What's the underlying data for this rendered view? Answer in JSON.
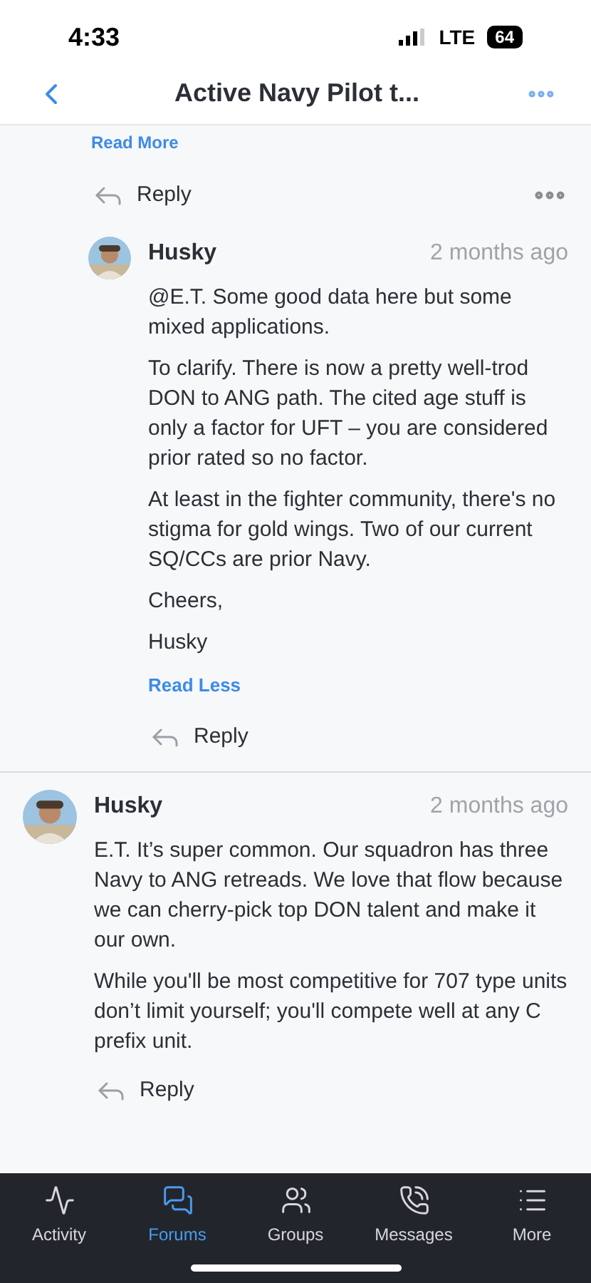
{
  "status_bar": {
    "time": "4:33",
    "network": "LTE",
    "battery": "64"
  },
  "header": {
    "title": "Active Navy Pilot t..."
  },
  "top_actions": {
    "link": "Read More",
    "reply": "Reply"
  },
  "comments": [
    {
      "nested": true,
      "author": "Husky",
      "time": "2 months ago",
      "paragraphs": [
        {
          "text": "@E.T. Some good data here but some mixed applications."
        },
        {
          "text": "To clarify. There is now a pretty well-trod DON to ANG path. The cited age stuff is only a factor for UFT – you are considered prior rated so no factor."
        },
        {
          "text": "At least in the fighter community, there's no stigma for gold wings. Two of our current SQ/CCs are prior Navy."
        },
        {
          "text": "Cheers,"
        },
        {
          "text": "Husky"
        }
      ],
      "toggle": "Read Less",
      "reply": "Reply"
    },
    {
      "nested": false,
      "author": "Husky",
      "time": "2 months ago",
      "paragraphs": [
        {
          "text": "E.T. It’s super common. Our squadron has three Navy to ANG retreads. We love that flow because we can cherry-pick top DON talent and make it our own."
        },
        {
          "text": "While you'll be most competitive for 707 type units don’t limit yourself; you'll compete well at any C prefix unit."
        }
      ],
      "reply": "Reply"
    }
  ],
  "tab_bar": [
    {
      "label": "Activity",
      "selected": false
    },
    {
      "label": "Forums",
      "selected": true
    },
    {
      "label": "Groups",
      "selected": false
    },
    {
      "label": "Messages",
      "selected": false
    },
    {
      "label": "More",
      "selected": false
    }
  ]
}
